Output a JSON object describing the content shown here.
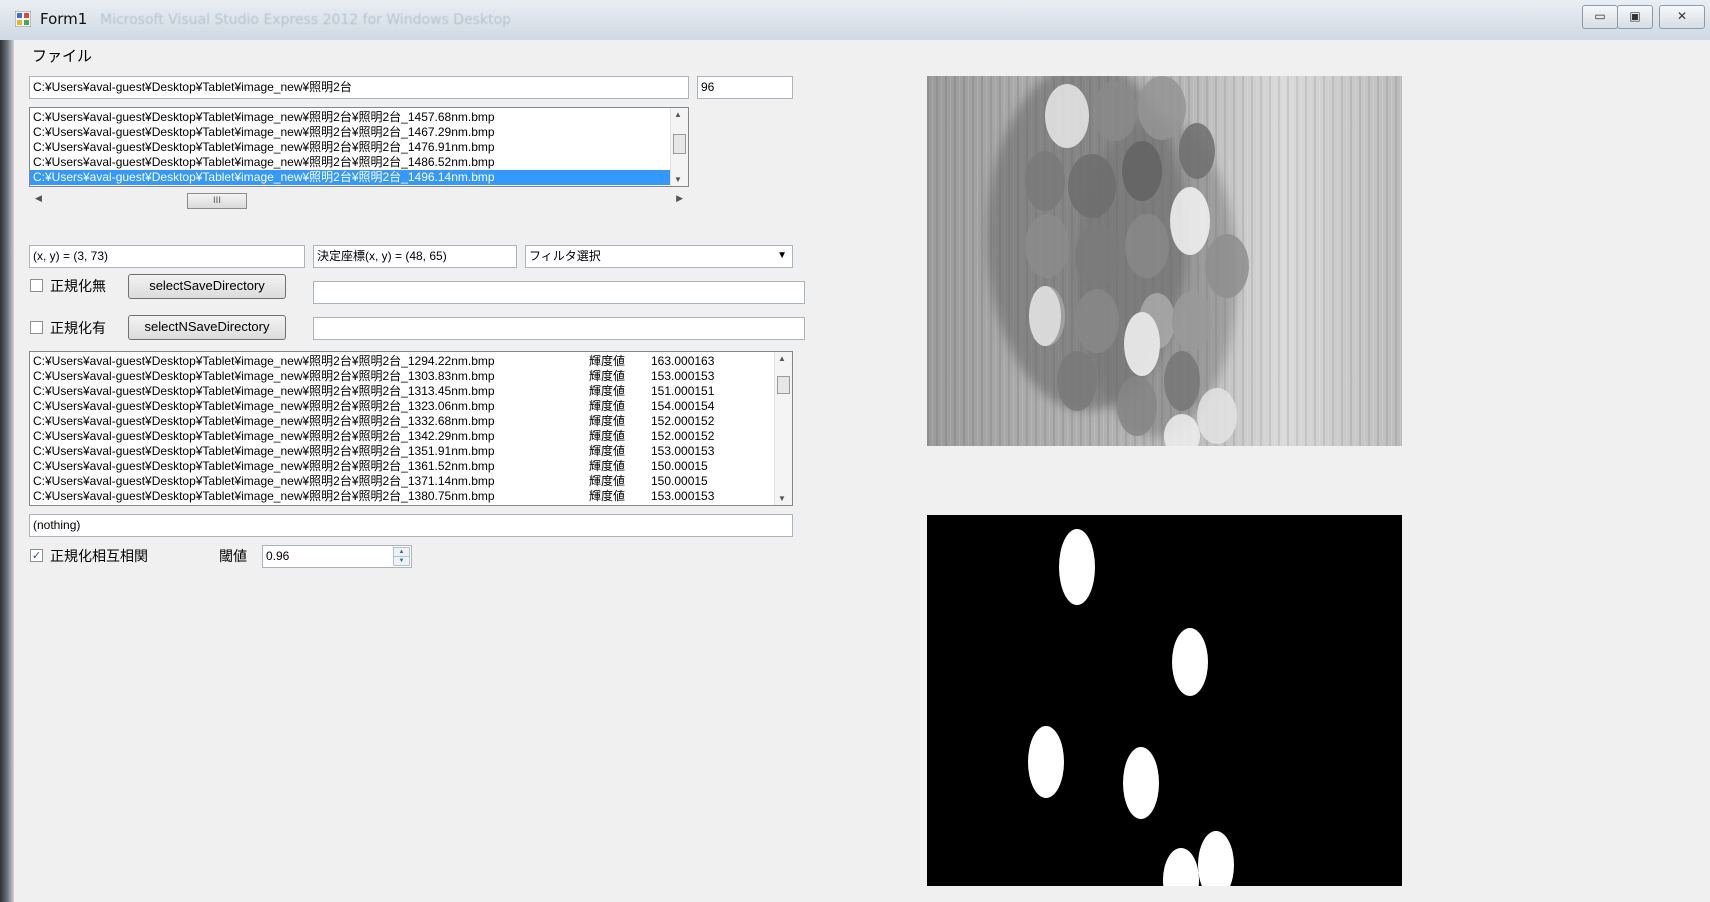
{
  "window": {
    "title": "Form1",
    "background_title": "Microsoft Visual Studio Express 2012 for Windows Desktop",
    "minimize": "▭",
    "maximize": "▣",
    "close": "✕"
  },
  "menu": {
    "file": "ファイル"
  },
  "path_input": "C:¥Users¥aval-guest¥Desktop¥Tablet¥image_new¥照明2台",
  "count_input": "96",
  "file_list": [
    "C:¥Users¥aval-guest¥Desktop¥Tablet¥image_new¥照明2台¥照明2台_1457.68nm.bmp",
    "C:¥Users¥aval-guest¥Desktop¥Tablet¥image_new¥照明2台¥照明2台_1467.29nm.bmp",
    "C:¥Users¥aval-guest¥Desktop¥Tablet¥image_new¥照明2台¥照明2台_1476.91nm.bmp",
    "C:¥Users¥aval-guest¥Desktop¥Tablet¥image_new¥照明2台¥照明2台_1486.52nm.bmp",
    "C:¥Users¥aval-guest¥Desktop¥Tablet¥image_new¥照明2台¥照明2台_1496.14nm.bmp"
  ],
  "hscroll_thumb": "III",
  "coord_text": "(x, y) = (3, 73)",
  "decided_coord": "決定座標(x, y) = (48, 65)",
  "filter_select": {
    "selected": "フィルタ選択"
  },
  "no_norm": {
    "label": "正規化無",
    "checked": false,
    "button": "selectSaveDirectory",
    "path": ""
  },
  "with_norm": {
    "label": "正規化有",
    "checked": false,
    "button": "selectNSaveDirectory",
    "path": ""
  },
  "result_list": [
    {
      "file": "C:¥Users¥aval-guest¥Desktop¥Tablet¥image_new¥照明2台¥照明2台_1294.22nm.bmp",
      "label": "輝度値",
      "value": "163.000163"
    },
    {
      "file": "C:¥Users¥aval-guest¥Desktop¥Tablet¥image_new¥照明2台¥照明2台_1303.83nm.bmp",
      "label": "輝度値",
      "value": "153.000153"
    },
    {
      "file": "C:¥Users¥aval-guest¥Desktop¥Tablet¥image_new¥照明2台¥照明2台_1313.45nm.bmp",
      "label": "輝度値",
      "value": "151.000151"
    },
    {
      "file": "C:¥Users¥aval-guest¥Desktop¥Tablet¥image_new¥照明2台¥照明2台_1323.06nm.bmp",
      "label": "輝度値",
      "value": "154.000154"
    },
    {
      "file": "C:¥Users¥aval-guest¥Desktop¥Tablet¥image_new¥照明2台¥照明2台_1332.68nm.bmp",
      "label": "輝度値",
      "value": "152.000152"
    },
    {
      "file": "C:¥Users¥aval-guest¥Desktop¥Tablet¥image_new¥照明2台¥照明2台_1342.29nm.bmp",
      "label": "輝度値",
      "value": "152.000152"
    },
    {
      "file": "C:¥Users¥aval-guest¥Desktop¥Tablet¥image_new¥照明2台¥照明2台_1351.91nm.bmp",
      "label": "輝度値",
      "value": "153.000153"
    },
    {
      "file": "C:¥Users¥aval-guest¥Desktop¥Tablet¥image_new¥照明2台¥照明2台_1361.52nm.bmp",
      "label": "輝度値",
      "value": "150.00015"
    },
    {
      "file": "C:¥Users¥aval-guest¥Desktop¥Tablet¥image_new¥照明2台¥照明2台_1371.14nm.bmp",
      "label": "輝度値",
      "value": "150.00015"
    },
    {
      "file": "C:¥Users¥aval-guest¥Desktop¥Tablet¥image_new¥照明2台¥照明2台_1380.75nm.bmp",
      "label": "輝度値",
      "value": "153.000153"
    }
  ],
  "status_text": "(nothing)",
  "ncc": {
    "label": "正規化相互相関",
    "checked": true,
    "threshold_label": "閾値",
    "threshold": "0.96"
  }
}
